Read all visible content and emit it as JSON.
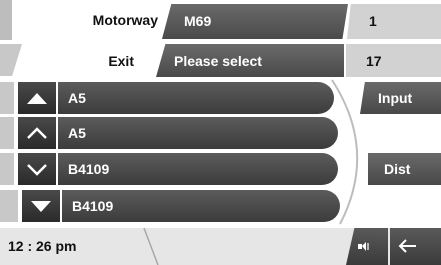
{
  "header": {
    "motorway_label": "Motorway",
    "motorway_value": "M69",
    "motorway_number": "1",
    "exit_label": "Exit",
    "exit_value": "Please select",
    "exit_number": "17"
  },
  "rows": [
    {
      "label": "A5",
      "arrow": "scroll-top-icon"
    },
    {
      "label": "A5",
      "arrow": "up-chevron-icon"
    },
    {
      "label": "B4109",
      "arrow": "down-chevron-icon"
    },
    {
      "label": "B4109",
      "arrow": "scroll-bottom-icon"
    }
  ],
  "side_buttons": {
    "input_label": "Input",
    "dist_label": "Dist"
  },
  "status": {
    "time": "12 : 26 pm",
    "sound_icon": "speaker-icon",
    "back_icon": "back-arrow-icon"
  },
  "colors": {
    "dark_bar": "#4a4a4a",
    "light_bar": "#d2d2d2",
    "background": "#ffffff"
  }
}
